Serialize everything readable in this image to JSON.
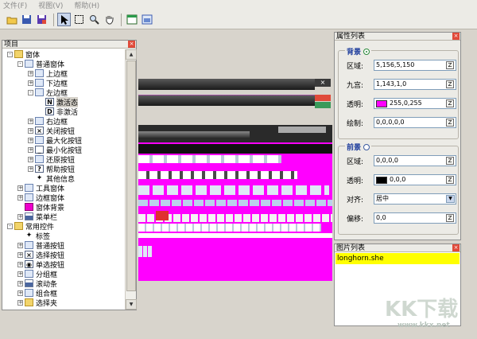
{
  "menu": [
    "文件(F)",
    "视图(V)",
    "帮助(H)"
  ],
  "tree_panel": {
    "title": "项目",
    "items": [
      {
        "label": "窗体",
        "level": 0,
        "pm": "-",
        "icon": "folder"
      },
      {
        "label": "普通窗体",
        "level": 1,
        "pm": "-",
        "icon": "win"
      },
      {
        "label": "上边框",
        "level": 2,
        "pm": "+",
        "icon": "win"
      },
      {
        "label": "下边框",
        "level": 2,
        "pm": "+",
        "icon": "win"
      },
      {
        "label": "左边框",
        "level": 2,
        "pm": "-",
        "icon": "win"
      },
      {
        "label": "激活态",
        "level": 3,
        "pm": "",
        "icon": "letter",
        "letter": "N"
      },
      {
        "label": "非激活",
        "level": 3,
        "pm": "",
        "icon": "letter",
        "letter": "D"
      },
      {
        "label": "右边框",
        "level": 2,
        "pm": "+",
        "icon": "win"
      },
      {
        "label": "关闭按钮",
        "level": 2,
        "pm": "+",
        "icon": "letter",
        "letter": "×"
      },
      {
        "label": "最大化按钮",
        "level": 2,
        "pm": "+",
        "icon": "win"
      },
      {
        "label": "最小化按钮",
        "level": 2,
        "pm": "+",
        "icon": "letter",
        "letter": "_"
      },
      {
        "label": "还原按钮",
        "level": 2,
        "pm": "+",
        "icon": "win"
      },
      {
        "label": "帮助按钮",
        "level": 2,
        "pm": "+",
        "icon": "letter",
        "letter": "?"
      },
      {
        "label": "其他信息",
        "level": 2,
        "pm": "",
        "icon": "star"
      },
      {
        "label": "工具窗体",
        "level": 1,
        "pm": "+",
        "icon": "win"
      },
      {
        "label": "边框窗体",
        "level": 1,
        "pm": "+",
        "icon": "win"
      },
      {
        "label": "窗体背景",
        "level": 1,
        "pm": "",
        "icon": "pink"
      },
      {
        "label": "菜单栏",
        "level": 1,
        "pm": "+",
        "icon": "bar"
      },
      {
        "label": "常用控件",
        "level": 0,
        "pm": "-",
        "icon": "folder"
      },
      {
        "label": "标签",
        "level": 1,
        "pm": "",
        "icon": "star"
      },
      {
        "label": "普通按钮",
        "level": 1,
        "pm": "+",
        "icon": "win"
      },
      {
        "label": "选择按钮",
        "level": 1,
        "pm": "+",
        "icon": "letter",
        "letter": "×"
      },
      {
        "label": "单选按钮",
        "level": 1,
        "pm": "+",
        "icon": "letter",
        "letter": "◉"
      },
      {
        "label": "分组框",
        "level": 1,
        "pm": "+",
        "icon": "win"
      },
      {
        "label": "滚动条",
        "level": 1,
        "pm": "+",
        "icon": "bar"
      },
      {
        "label": "组合框",
        "level": 1,
        "pm": "+",
        "icon": "win"
      },
      {
        "label": "选择夹",
        "level": 1,
        "pm": "+",
        "icon": "folder"
      }
    ],
    "selected_index": 5
  },
  "prop_panel": {
    "title": "属性列表",
    "bg_group": {
      "title": "背景",
      "region_label": "区域:",
      "region_value": "5,156,5,150",
      "grid_label": "九宫:",
      "grid_value": "1,143,1,0",
      "alpha_label": "透明:",
      "alpha_value": "255,0,255",
      "alpha_color": "#ff00ff",
      "draw_label": "绘制:",
      "draw_value": "0,0,0,0,0"
    },
    "fg_group": {
      "title": "前景",
      "region_label": "区域:",
      "region_value": "0,0,0,0",
      "alpha_label": "透明:",
      "alpha_value": "0,0,0",
      "alpha_color": "#000000",
      "align_label": "对齐:",
      "align_value": "居中",
      "offset_label": "偏移:",
      "offset_value": "0,0"
    },
    "z_label": "Z"
  },
  "img_panel": {
    "title": "图片列表",
    "items": [
      "longhorn.she"
    ]
  },
  "watermark": {
    "brand": "KK下载",
    "url": "www.kkx.net"
  }
}
